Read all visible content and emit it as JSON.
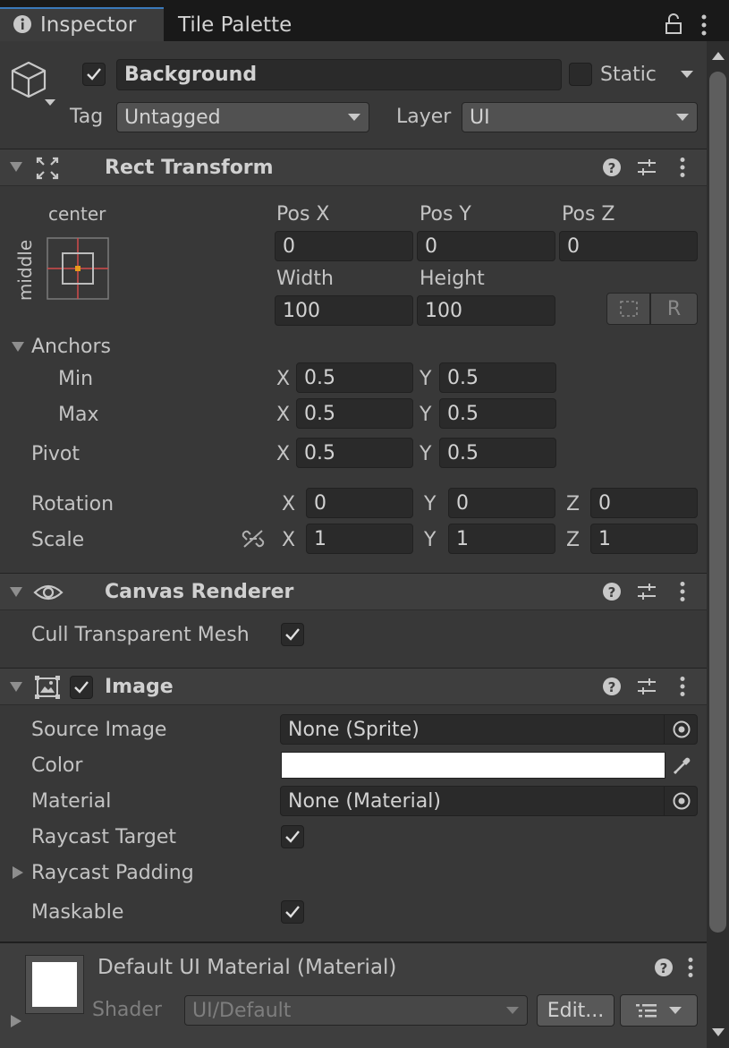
{
  "tabs": {
    "inspector": "Inspector",
    "tile_palette": "Tile Palette"
  },
  "object": {
    "name": "Background",
    "active": true,
    "static_label": "Static",
    "static": false,
    "tag_label": "Tag",
    "tag_value": "Untagged",
    "layer_label": "Layer",
    "layer_value": "UI"
  },
  "rect_transform": {
    "title": "Rect Transform",
    "anchor_preset_h": "center",
    "anchor_preset_v": "middle",
    "pos_x_label": "Pos X",
    "pos_y_label": "Pos Y",
    "pos_z_label": "Pos Z",
    "pos_x": "0",
    "pos_y": "0",
    "pos_z": "0",
    "width_label": "Width",
    "height_label": "Height",
    "width": "100",
    "height": "100",
    "raw_button": "R",
    "anchors_label": "Anchors",
    "min_label": "Min",
    "max_label": "Max",
    "min_x": "0.5",
    "min_y": "0.5",
    "max_x": "0.5",
    "max_y": "0.5",
    "pivot_label": "Pivot",
    "pivot_x": "0.5",
    "pivot_y": "0.5",
    "rotation_label": "Rotation",
    "rot_x": "0",
    "rot_y": "0",
    "rot_z": "0",
    "scale_label": "Scale",
    "scale_x": "1",
    "scale_y": "1",
    "scale_z": "1",
    "x": "X",
    "y": "Y",
    "z": "Z"
  },
  "canvas_renderer": {
    "title": "Canvas Renderer",
    "cull_label": "Cull Transparent Mesh",
    "cull": true
  },
  "image": {
    "title": "Image",
    "enabled": true,
    "source_label": "Source Image",
    "source_value": "None (Sprite)",
    "color_label": "Color",
    "color_value": "#ffffff",
    "material_label": "Material",
    "material_value": "None (Material)",
    "raycast_target_label": "Raycast Target",
    "raycast_target": true,
    "raycast_padding_label": "Raycast Padding",
    "maskable_label": "Maskable",
    "maskable": true
  },
  "material": {
    "title": "Default UI Material (Material)",
    "shader_label": "Shader",
    "shader_value": "UI/Default",
    "edit_button": "Edit..."
  },
  "colors": {
    "accent": "#3a79bb",
    "anchor_red": "#d24b4b",
    "pivot_orange": "#e89a1a"
  }
}
